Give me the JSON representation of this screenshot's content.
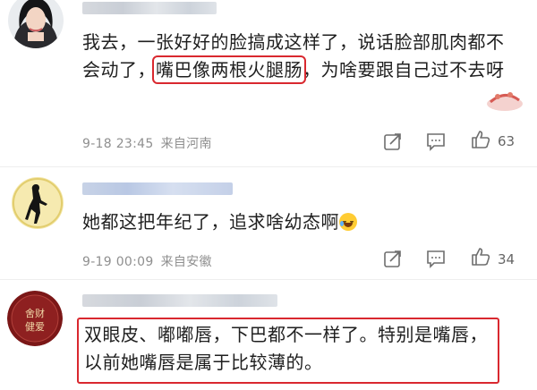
{
  "comments": [
    {
      "avatar": "woman-portrait-avatar",
      "text_before": "我去，一张好好的脸搞成这样了，说话脸部肌肉都不会动了，",
      "text_highlight": "嘴巴像两根火腿肠",
      "text_after": "，为啥要跟自己过不去呀",
      "date": "9-18 23:45",
      "location": "来自河南",
      "likes": "63"
    },
    {
      "avatar": "silhouette-avatar",
      "text": "她都这把年纪了，追求啥幼态啊",
      "emoji": "laugh-cry-emoji",
      "date": "9-19 00:09",
      "location": "来自安徽",
      "likes": "34"
    },
    {
      "avatar": "red-seal-avatar",
      "avatar_text": "舍财健爱",
      "text": "双眼皮、嘟嘟唇，下巴都不一样了。特别是嘴唇，以前她嘴唇是属于比较薄的。"
    }
  ],
  "colors": {
    "highlight": "#d9282f",
    "meta": "#8f8f8f",
    "seal": "#8a1c1c"
  }
}
